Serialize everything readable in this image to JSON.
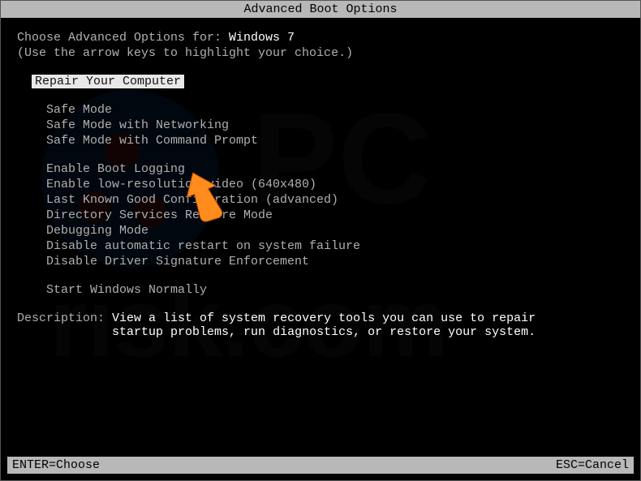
{
  "title": "Advanced Boot Options",
  "choose_prefix": "Choose Advanced Options for: ",
  "os_name": "Windows 7",
  "hint": "(Use the arrow keys to highlight your choice.)",
  "highlighted_option": "Repair Your Computer",
  "group1": [
    "Safe Mode",
    "Safe Mode with Networking",
    "Safe Mode with Command Prompt"
  ],
  "group2": [
    "Enable Boot Logging",
    "Enable low-resolution video (640x480)",
    "Last Known Good Configuration (advanced)",
    "Directory Services Restore Mode",
    "Debugging Mode",
    "Disable automatic restart on system failure",
    "Disable Driver Signature Enforcement"
  ],
  "group3": [
    "Start Windows Normally"
  ],
  "description_label": "Description: ",
  "description_line1": "View a list of system recovery tools you can use to repair",
  "description_line2": "startup problems, run diagnostics, or restore your system.",
  "footer_left": "ENTER=Choose",
  "footer_right": "ESC=Cancel"
}
